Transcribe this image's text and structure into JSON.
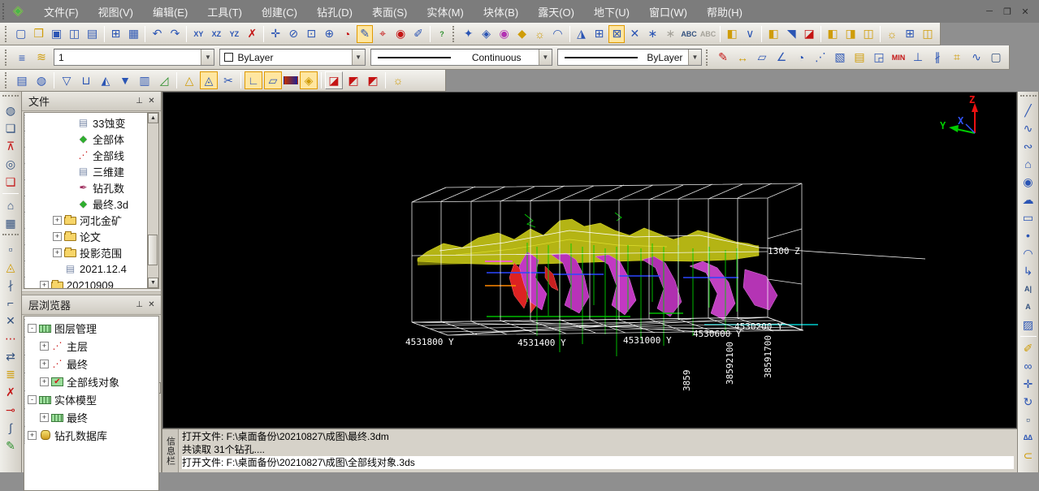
{
  "app": {
    "icon": "app-diamond-icon",
    "window_buttons": [
      {
        "n": "minimize-button",
        "g": "─"
      },
      {
        "n": "restore-button",
        "g": "❐"
      },
      {
        "n": "close-button",
        "g": "✕"
      }
    ]
  },
  "menu_bar": {
    "items": [
      "文件(F)",
      "视图(V)",
      "编辑(E)",
      "工具(T)",
      "创建(C)",
      "钻孔(D)",
      "表面(S)",
      "实体(M)",
      "块体(B)",
      "露天(O)",
      "地下(U)",
      "窗口(W)",
      "帮助(H)"
    ]
  },
  "toolbars": {
    "standard": [
      {
        "grip": true
      },
      {
        "n": "new-file-icon",
        "g": "▢",
        "c": "blue"
      },
      {
        "n": "open-file-icon",
        "g": "❒",
        "c": "yellow"
      },
      {
        "n": "save-icon",
        "g": "▣",
        "c": "blue"
      },
      {
        "n": "save-as-icon",
        "g": "◫",
        "c": "blue"
      },
      {
        "n": "edit-doc-icon",
        "g": "▤",
        "c": "blue"
      },
      {
        "sep": true
      },
      {
        "n": "page-setup-icon",
        "g": "⊞",
        "c": "blue"
      },
      {
        "n": "print-icon",
        "g": "▦",
        "c": "blue"
      },
      {
        "sep": true
      },
      {
        "n": "undo-icon",
        "g": "↶",
        "c": "blue"
      },
      {
        "n": "redo-icon",
        "g": "↷",
        "c": "blue"
      },
      {
        "sep": true
      },
      {
        "n": "view-xy-icon",
        "g": "XY",
        "txt": true,
        "c": "blue"
      },
      {
        "n": "view-xz-icon",
        "g": "XZ",
        "txt": true,
        "c": "blue"
      },
      {
        "n": "view-yz-icon",
        "g": "YZ",
        "txt": true,
        "c": "blue"
      },
      {
        "n": "delete-icon",
        "g": "✗",
        "c": "red"
      },
      {
        "sep": true
      },
      {
        "n": "pan-icon",
        "g": "✛",
        "c": "blue"
      },
      {
        "n": "zoom-dynamic-icon",
        "g": "⊘",
        "c": "blue"
      },
      {
        "n": "zoom-window-icon",
        "g": "⊡",
        "c": "blue"
      },
      {
        "n": "zoom-in-icon",
        "g": "⊕",
        "c": "blue"
      },
      {
        "n": "orbit-icon",
        "g": "◔",
        "c": "red"
      },
      {
        "n": "select-paint-icon",
        "g": "✎",
        "on": true,
        "c": "blue"
      },
      {
        "n": "center-target-icon",
        "g": "⌖",
        "c": "red"
      },
      {
        "n": "zoom-object-icon",
        "g": "◉",
        "c": "red"
      },
      {
        "n": "brush-icon",
        "g": "✐",
        "c": "blue"
      },
      {
        "sep": true
      },
      {
        "n": "help-icon",
        "g": "?",
        "txt": true,
        "c": "green"
      },
      {
        "grip": true
      },
      {
        "n": "view-compass-icon",
        "g": "✦",
        "c": "blue"
      },
      {
        "n": "view-diamond-icon",
        "g": "◈",
        "c": "blue"
      },
      {
        "n": "render-color-icon",
        "g": "◉",
        "c": "magenta"
      },
      {
        "n": "shade-icon",
        "g": "◆",
        "c": "yellow"
      },
      {
        "n": "light-icon",
        "g": "☼",
        "c": "yellow"
      },
      {
        "n": "arc-rotate-icon",
        "g": "◠",
        "c": "blue"
      },
      {
        "sep": true
      },
      {
        "n": "grid-arrow-icon",
        "g": "◮",
        "c": "blue"
      },
      {
        "n": "grid-icon",
        "g": "⊞",
        "c": "blue"
      },
      {
        "n": "grid-box-icon",
        "g": "⊠",
        "on": true,
        "c": "blue"
      },
      {
        "n": "cross-icon",
        "g": "✕",
        "c": "blue"
      },
      {
        "n": "snap-icon",
        "g": "∗",
        "c": "blue"
      },
      {
        "n": "snap-alt-icon",
        "g": "∗",
        "dis": true
      },
      {
        "n": "text-abc-icon",
        "g": "ABC",
        "txt": true
      },
      {
        "n": "text-abc-disabled-icon",
        "g": "ABC",
        "txt": true,
        "dis": true
      },
      {
        "sep": true
      },
      {
        "n": "section-plane-icon",
        "g": "◧",
        "c": "yellow"
      },
      {
        "n": "section-fork-icon",
        "g": "∨",
        "c": "blue"
      },
      {
        "sep": true
      },
      {
        "n": "plane-forward-icon",
        "g": "◧",
        "c": "yellow"
      },
      {
        "n": "plane-shape-icon",
        "g": "◥",
        "c": "blue"
      },
      {
        "n": "plane-delete-icon",
        "g": "◪",
        "c": "red"
      },
      {
        "sep": true
      },
      {
        "n": "section-prev-icon",
        "g": "◧",
        "c": "yellow"
      },
      {
        "n": "section-next-icon",
        "g": "◨",
        "c": "yellow"
      },
      {
        "n": "section-sync-icon",
        "g": "◫",
        "c": "yellow"
      },
      {
        "sep": true
      },
      {
        "n": "bulb-grid-icon",
        "g": "☼",
        "c": "yellow"
      },
      {
        "n": "big-grid-icon",
        "g": "⊞",
        "c": "blue"
      },
      {
        "n": "door-icon",
        "g": "◫",
        "c": "yellow"
      }
    ],
    "properties": {
      "prefix_icons": [
        {
          "grip": true
        },
        {
          "n": "layers-icon",
          "g": "≡",
          "c": "blue"
        },
        {
          "n": "layer-edit-icon",
          "g": "≋",
          "c": "yellow"
        }
      ],
      "layer": "1",
      "color": "ByLayer",
      "linetype": "Continuous",
      "lineweight": "ByLayer",
      "measure_icons": [
        {
          "grip": true
        },
        {
          "n": "point-draw-icon",
          "g": "✎",
          "c": "red"
        },
        {
          "n": "distance-icon",
          "g": "↔",
          "c": "yellow"
        },
        {
          "n": "area-icon",
          "g": "▱",
          "c": "blue"
        },
        {
          "n": "angle-icon",
          "g": "∠",
          "c": "blue"
        },
        {
          "n": "arc-length-icon",
          "g": "◔",
          "c": "blue"
        },
        {
          "n": "path-points-icon",
          "g": "⋰",
          "c": "blue"
        },
        {
          "n": "volume-cube-icon",
          "g": "▧",
          "c": "blue"
        },
        {
          "n": "report-icon",
          "g": "▤",
          "c": "yellow"
        },
        {
          "n": "zoom-region-icon",
          "g": "◲",
          "c": "blue"
        },
        {
          "n": "min-distance-icon",
          "g": "MIN",
          "txt": true,
          "c": "red"
        },
        {
          "n": "perpendicular-icon",
          "g": "⊥",
          "c": "blue"
        },
        {
          "n": "profile-lines-icon",
          "g": "∦",
          "c": "blue"
        },
        {
          "n": "station-icon",
          "g": "⌗",
          "c": "yellow"
        },
        {
          "n": "walk-mode-icon",
          "g": "∿",
          "c": "blue"
        },
        {
          "n": "blank-swatch-icon",
          "g": "▢"
        }
      ]
    },
    "surface": [
      {
        "grip": true
      },
      {
        "n": "mesh-rect-icon",
        "g": "▤",
        "c": "blue"
      },
      {
        "n": "mesh-round-icon",
        "g": "◍",
        "c": "blue"
      },
      {
        "sep": true
      },
      {
        "n": "tri-down-icon",
        "g": "▽",
        "c": "blue"
      },
      {
        "n": "cylinder-icon",
        "g": "⊔",
        "c": "blue"
      },
      {
        "n": "cone-mesh-icon",
        "g": "◭",
        "c": "blue"
      },
      {
        "n": "basket-mesh-icon",
        "g": "▼",
        "c": "blue"
      },
      {
        "n": "column-mesh-icon",
        "g": "▥",
        "c": "blue"
      },
      {
        "n": "slope-edit-icon",
        "g": "◿",
        "c": "green"
      },
      {
        "sep": true
      },
      {
        "n": "tri-marker-icon",
        "g": "△",
        "c": "yellow"
      },
      {
        "n": "circle-tri-icon",
        "g": "◬",
        "on": true,
        "c": "blue"
      },
      {
        "n": "scissors-icon",
        "g": "✂",
        "c": "blue"
      },
      {
        "sep": true
      },
      {
        "n": "profile-axis-icon",
        "g": "∟",
        "on": true,
        "c": "blue"
      },
      {
        "n": "trapezoid-icon",
        "g": "▱",
        "on": true,
        "c": "blue"
      },
      {
        "n": "gradient-bar-icon",
        "g": "▮",
        "c": "grad"
      },
      {
        "n": "diamond-arrows-icon",
        "g": "◈",
        "on": true,
        "c": "yellow"
      },
      {
        "sep": true
      },
      {
        "n": "chart-view-icon",
        "g": "◪",
        "raised": true,
        "c": "red"
      },
      {
        "n": "chart-red-icon",
        "g": "◩",
        "c": "red"
      },
      {
        "n": "chart-red2-icon",
        "g": "◩",
        "c": "red"
      },
      {
        "sep": true
      },
      {
        "n": "bulb-surface-icon",
        "g": "☼",
        "c": "yellow"
      }
    ],
    "left_vertical": [
      {
        "grip": true
      },
      {
        "n": "surface-sphere-icon",
        "g": "◍"
      },
      {
        "n": "surface-select-icon",
        "g": "❏"
      },
      {
        "n": "surface-pin-icon",
        "g": "⊼",
        "c": "red"
      },
      {
        "n": "surface-lasso-icon",
        "g": "◎"
      },
      {
        "n": "surface-clear-icon",
        "g": "❏",
        "c": "red"
      },
      {
        "sep": true
      },
      {
        "n": "surface-poly-icon",
        "g": "⌂"
      },
      {
        "n": "surface-calc-icon",
        "g": "▦"
      },
      {
        "grip": true
      },
      {
        "n": "rect-dash-icon",
        "g": "▫"
      },
      {
        "n": "cone-flag-icon",
        "g": "◬",
        "c": "yellow"
      },
      {
        "n": "line-cut-icon",
        "g": "∤"
      },
      {
        "n": "corner-icon",
        "g": "⌐"
      },
      {
        "n": "cross-delete-icon",
        "g": "✕"
      },
      {
        "n": "dots-row-icon",
        "g": "⋯",
        "c": "red"
      },
      {
        "n": "swap-icon",
        "g": "⇄"
      },
      {
        "n": "fence-icon",
        "g": "≣",
        "c": "yellow"
      },
      {
        "n": "line-delete-icon",
        "g": "✗",
        "c": "red"
      },
      {
        "n": "point-insert-icon",
        "g": "⊸",
        "c": "red"
      },
      {
        "n": "line-join-icon",
        "g": "∫"
      },
      {
        "n": "erase-draw-icon",
        "g": "✎",
        "c": "green"
      }
    ],
    "right_vertical": [
      {
        "grip": true
      },
      {
        "n": "line-icon",
        "g": "╱",
        "c": "blue"
      },
      {
        "n": "polyline-icon",
        "g": "∿",
        "c": "blue"
      },
      {
        "n": "spline-icon",
        "g": "∾",
        "c": "blue"
      },
      {
        "n": "polygon-icon",
        "g": "⌂",
        "c": "blue"
      },
      {
        "n": "circle-icon",
        "g": "◉",
        "c": "blue"
      },
      {
        "n": "cloud-icon",
        "g": "☁",
        "c": "blue"
      },
      {
        "n": "rectangle-icon",
        "g": "▭",
        "c": "blue"
      },
      {
        "n": "point-icon",
        "g": "•",
        "c": "blue"
      },
      {
        "n": "arc-icon",
        "g": "◠",
        "c": "blue"
      },
      {
        "n": "leader-icon",
        "g": "↳",
        "c": "blue"
      },
      {
        "n": "text-edit-icon",
        "g": "A|",
        "txt": true
      },
      {
        "n": "text-icon",
        "g": "A",
        "txt": true
      },
      {
        "n": "hatch-icon",
        "g": "▨",
        "c": "blue"
      },
      {
        "sep": true
      },
      {
        "n": "eraser-icon",
        "g": "✐",
        "c": "yellow"
      },
      {
        "n": "group-icon",
        "g": "∞",
        "c": "blue"
      },
      {
        "n": "move-icon",
        "g": "✛",
        "c": "blue"
      },
      {
        "n": "rotate-icon",
        "g": "↻",
        "c": "blue"
      },
      {
        "n": "select-box-icon",
        "g": "▫"
      },
      {
        "n": "mirror-icon",
        "g": "∆∆",
        "txt": true,
        "c": "blue"
      },
      {
        "n": "offset-icon",
        "g": "⊂",
        "c": "yellow"
      }
    ]
  },
  "panels": {
    "files": {
      "title": "文件",
      "items": [
        {
          "d": 3,
          "ic": "doc",
          "g": "▤",
          "label": "33蚀变"
        },
        {
          "d": 3,
          "ic": "diamond",
          "g": "◆",
          "label": "全部体"
        },
        {
          "d": 3,
          "ic": "lines",
          "g": "⋰",
          "label": "全部线"
        },
        {
          "d": 3,
          "ic": "doc",
          "g": "▤",
          "label": "三维建"
        },
        {
          "d": 3,
          "ic": "drill",
          "g": "✒",
          "label": "钻孔数"
        },
        {
          "d": 3,
          "ic": "diamond",
          "g": "◆",
          "label": "最终.3d"
        },
        {
          "d": 2,
          "exp": "+",
          "ic": "folder",
          "label": "河北金矿"
        },
        {
          "d": 2,
          "exp": "+",
          "ic": "folder",
          "label": "论文"
        },
        {
          "d": 2,
          "exp": "+",
          "ic": "folder",
          "label": "投影范围"
        },
        {
          "d": 2,
          "ic": "doc",
          "g": "▤",
          "label": "2021.12.4"
        },
        {
          "d": 1,
          "exp": "+",
          "ic": "folder",
          "label": "20210909"
        }
      ]
    },
    "layers": {
      "title": "层浏览器",
      "items": [
        {
          "d": 0,
          "exp": "-",
          "ic": "layer",
          "label": "图层管理"
        },
        {
          "d": 1,
          "exp": "+",
          "ic": "lines",
          "g": "⋰",
          "label": "主层"
        },
        {
          "d": 1,
          "exp": "+",
          "ic": "lines",
          "g": "⋰",
          "label": "最终"
        },
        {
          "d": 1,
          "exp": "+",
          "ic": "check",
          "g": "✔",
          "label": "全部线对象"
        },
        {
          "d": 0,
          "exp": "-",
          "ic": "layer",
          "label": "实体模型"
        },
        {
          "d": 1,
          "exp": "+",
          "ic": "layer",
          "label": "最终"
        },
        {
          "d": 0,
          "exp": "+",
          "ic": "db",
          "label": "钻孔数据库"
        }
      ]
    }
  },
  "viewport": {
    "axis": {
      "x": "X",
      "y": "Y",
      "z": "Z"
    },
    "grid_labels_y": [
      "4531800 Y",
      "4531400 Y",
      "4531000 Y",
      "4530600 Y",
      "4530200 Y"
    ],
    "grid_labels_x": [
      "3859",
      "38592100",
      "38591700"
    ],
    "elev_label": "1300 Z"
  },
  "output": {
    "tab": "信息栏",
    "lines": [
      "打开文件: F:\\桌面备份\\20210827\\成图\\最终.3dm",
      "共读取 31个钻孔....",
      "打开文件: F:\\桌面备份\\20210827\\成图\\全部线对象.3ds"
    ]
  }
}
